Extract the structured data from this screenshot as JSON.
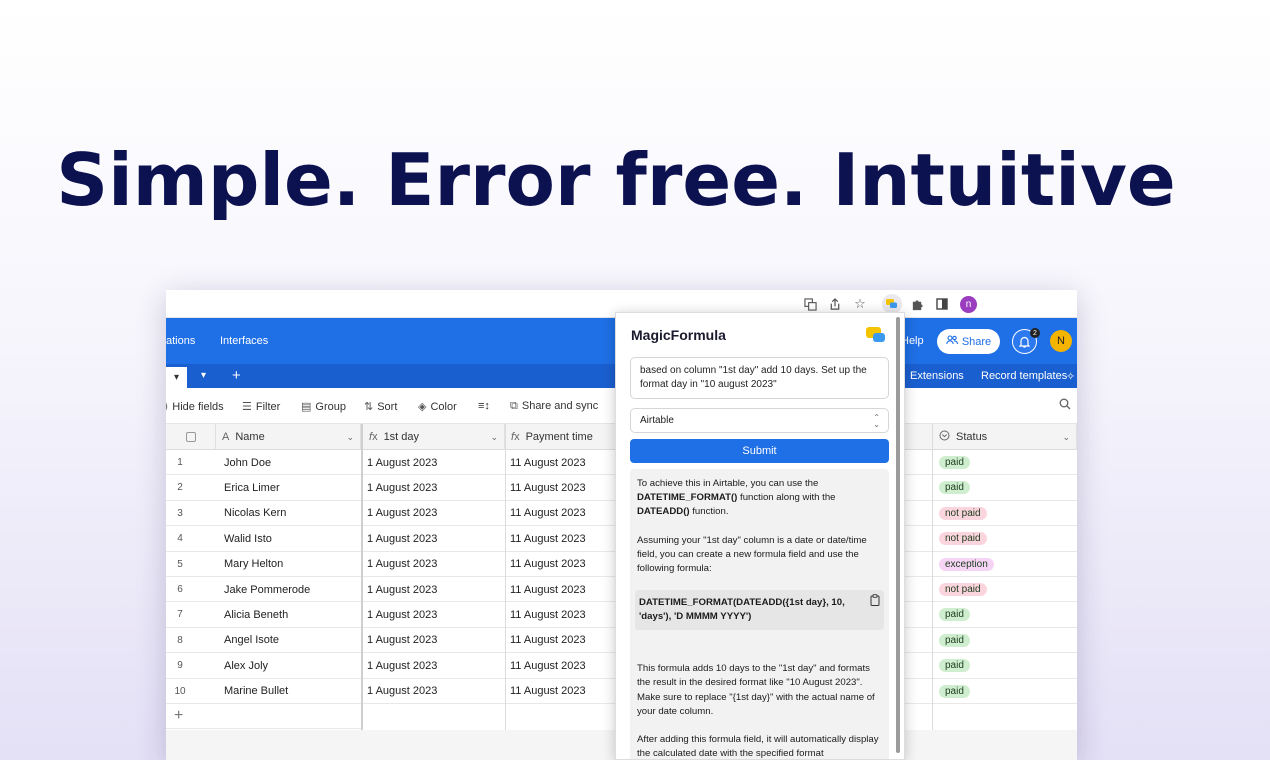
{
  "hero": {
    "title": "Simple. Error free. Intuitive"
  },
  "chrome": {
    "icons": [
      "translate-icon",
      "share-icon",
      "star-icon",
      "magicformula-extension-icon",
      "puzzle-icon",
      "sidebar-icon"
    ],
    "profile_initial": "n"
  },
  "topbar": {
    "nav": [
      "ations",
      "Interfaces"
    ],
    "help": "Help",
    "share_label": "Share",
    "notification_count": "2",
    "user_initial": "N"
  },
  "tabbar": {
    "add": "+",
    "extensions": "Extensions",
    "record_templates": "Record templates"
  },
  "toolbar": {
    "hide_fields": "Hide fields",
    "filter": "Filter",
    "group": "Group",
    "sort": "Sort",
    "color": "Color",
    "share_sync": "Share and sync"
  },
  "table": {
    "headers": {
      "name": "Name",
      "first_day": "1st day",
      "payment_time": "Payment time",
      "status": "Status"
    },
    "rows": [
      {
        "n": "1",
        "name": "John Doe",
        "first_day": "1 August 2023",
        "payment_time": "11 August 2023",
        "status": "paid"
      },
      {
        "n": "2",
        "name": "Erica Limer",
        "first_day": "1 August 2023",
        "payment_time": "11 August 2023",
        "status": "paid"
      },
      {
        "n": "3",
        "name": "Nicolas Kern",
        "first_day": "1 August 2023",
        "payment_time": "11 August 2023",
        "status": "not paid"
      },
      {
        "n": "4",
        "name": "Walid Isto",
        "first_day": "1 August 2023",
        "payment_time": "11 August 2023",
        "status": "not paid"
      },
      {
        "n": "5",
        "name": "Mary Helton",
        "first_day": "1 August 2023",
        "payment_time": "11 August 2023",
        "status": "exception"
      },
      {
        "n": "6",
        "name": "Jake Pommerode",
        "first_day": "1 August 2023",
        "payment_time": "11 August 2023",
        "status": "not paid"
      },
      {
        "n": "7",
        "name": "Alicia Beneth",
        "first_day": "1 August 2023",
        "payment_time": "11 August 2023",
        "status": "paid"
      },
      {
        "n": "8",
        "name": "Angel Isote",
        "first_day": "1 August 2023",
        "payment_time": "11 August 2023",
        "status": "paid"
      },
      {
        "n": "9",
        "name": "Alex Joly",
        "first_day": "1 August 2023",
        "payment_time": "11 August 2023",
        "status": "paid"
      },
      {
        "n": "10",
        "name": "Marine Bullet",
        "first_day": "1 August 2023",
        "payment_time": "11 August 2023",
        "status": "paid"
      }
    ],
    "add_row": "+",
    "status_colors": {
      "paid": "#cfeecf",
      "not paid": "#fbd5dd",
      "exception": "#f6d4f5"
    }
  },
  "popup": {
    "title": "MagicFormula",
    "prompt": "based on column \"1st day\" add 10 days. Set up the format day in \"10 august 2023\"",
    "select_value": "Airtable",
    "submit_label": "Submit",
    "answer": {
      "p1_a": "To achieve this in Airtable, you can use the ",
      "p1_b": "DATETIME_FORMAT()",
      "p1_c": " function along with the ",
      "p1_d": "DATEADD()",
      "p1_e": " function.",
      "p2": "Assuming your \"1st day\" column is a date or date/time field, you can create a new formula field and use the following formula:",
      "code": "DATETIME_FORMAT(DATEADD({1st day}, 10, 'days'), 'D MMMM YYYY')",
      "p3": "This formula adds 10 days to the \"1st day\" and formats the result in the desired format like \"10 August 2023\". Make sure to replace \"{1st day}\" with the actual name of your date column.",
      "p4": "After adding this formula field, it will automatically display the calculated date with the specified format"
    }
  },
  "colors": {
    "hero": "#0c1150",
    "brand_blue": "#1f6fe6"
  }
}
